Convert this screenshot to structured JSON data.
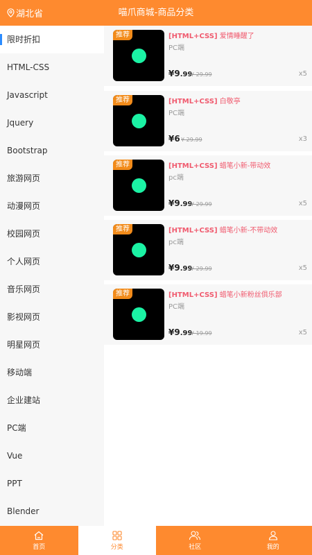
{
  "header": {
    "location": "湖北省",
    "title": "喵爪商城-商品分类"
  },
  "sidebar": {
    "items": [
      {
        "label": "限时折扣"
      },
      {
        "label": "HTML-CSS"
      },
      {
        "label": "Javascript"
      },
      {
        "label": "Jquery"
      },
      {
        "label": "Bootstrap"
      },
      {
        "label": "旅游网页"
      },
      {
        "label": "动漫网页"
      },
      {
        "label": "校园网页"
      },
      {
        "label": "个人网页"
      },
      {
        "label": "音乐网页"
      },
      {
        "label": "影视网页"
      },
      {
        "label": "明星网页"
      },
      {
        "label": "移动端"
      },
      {
        "label": "企业建站"
      },
      {
        "label": "PC端"
      },
      {
        "label": "Vue"
      },
      {
        "label": "PPT"
      },
      {
        "label": "Blender"
      }
    ]
  },
  "products": [
    {
      "tag": "推荐",
      "prefix": "[HTML+CSS]",
      "name": "爱情睡醒了",
      "platform": "PC端",
      "price_int": "¥9",
      "price_dec": ".99",
      "original": "¥ 29.99",
      "qty": "x5"
    },
    {
      "tag": "推荐",
      "prefix": "[HTML+CSS]",
      "name": "白敬亭",
      "platform": "PC端",
      "price_int": "¥6",
      "price_dec": "",
      "original": "¥ 29.99",
      "qty": "x3"
    },
    {
      "tag": "推荐",
      "prefix": "[HTML+CSS]",
      "name": "蜡笔小新-带动效",
      "platform": "pc端",
      "price_int": "¥9",
      "price_dec": ".99",
      "original": "¥ 29.99",
      "qty": "x5"
    },
    {
      "tag": "推荐",
      "prefix": "[HTML+CSS]",
      "name": "蜡笔小新-不带动效",
      "platform": "pc端",
      "price_int": "¥9",
      "price_dec": ".99",
      "original": "¥ 29.99",
      "qty": "x5"
    },
    {
      "tag": "推荐",
      "prefix": "[HTML+CSS]",
      "name": "蜡笔小新粉丝俱乐部",
      "platform": "PC端",
      "price_int": "¥9",
      "price_dec": ".99",
      "original": "¥ 19.99",
      "qty": "x5"
    }
  ],
  "tabbar": {
    "home": "首页",
    "category": "分类",
    "community": "社区",
    "mine": "我的"
  },
  "icons": {
    "location": "location-pin-icon",
    "home": "home-icon",
    "category": "category-grid-icon",
    "community": "community-icon",
    "mine": "user-icon"
  },
  "colors": {
    "brand_orange": "#fe8a2f",
    "tag_orange": "#f28b1a",
    "title_pink": "#f05a6e",
    "active_indicator": "#2b8cff",
    "thumb_dot": "#1bf2a4"
  }
}
